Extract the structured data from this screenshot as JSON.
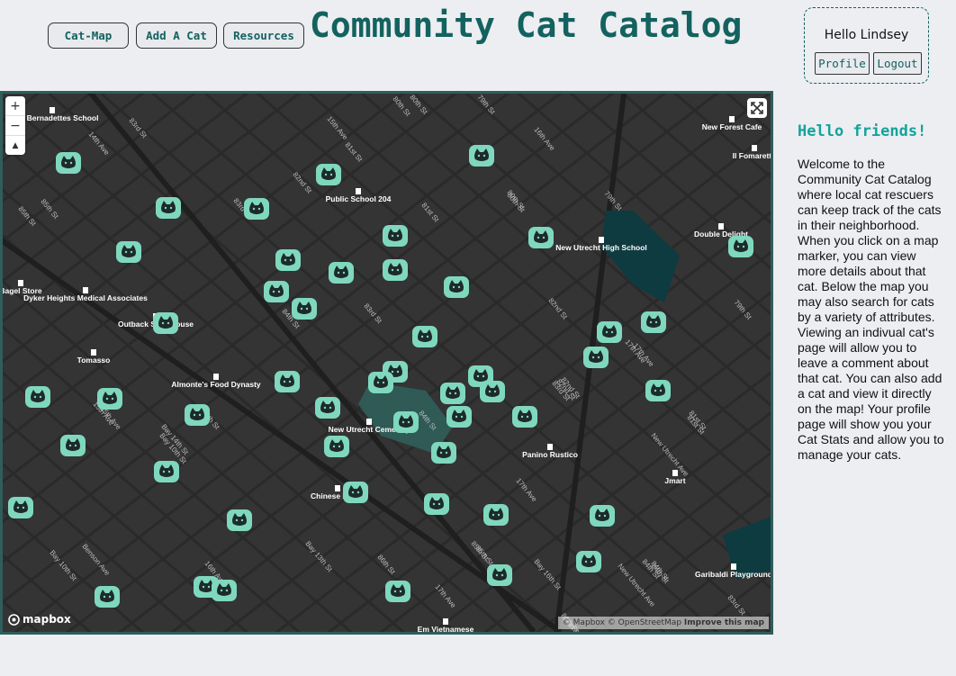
{
  "nav": {
    "cat_map": "Cat-Map",
    "add_cat": "Add A Cat",
    "resources": "Resources"
  },
  "title": "Community Cat Catalog",
  "user": {
    "greeting": "Hello Lindsey",
    "profile": "Profile",
    "logout": "Logout"
  },
  "map": {
    "zoom_in": "+",
    "zoom_out": "−",
    "compass": "▲",
    "logo_text": "mapbox",
    "attribution": {
      "mapbox": "© Mapbox",
      "osm": "© OpenStreetMap",
      "improve": "Improve this map"
    },
    "street_labels": [
      "83rd St",
      "15th Ave",
      "80th St",
      "79th St",
      "16th Ave",
      "14th Ave",
      "82nd St",
      "81st St",
      "80th St",
      "85th St",
      "83rd St",
      "79th St",
      "81st St",
      "80th St",
      "79th St",
      "82nd St",
      "84th St",
      "83rd St",
      "82nd St",
      "81st St",
      "17th Ave",
      "86th St",
      "15th Ave",
      "Bay 10th St",
      "84th St",
      "Bay 16th St",
      "Bay 13th St",
      "16th Ave",
      "85th St",
      "86th St",
      "17th Ave",
      "Benson Ave",
      "Bay 10th St",
      "85th St",
      "84th St",
      "83rd St",
      "New Utrecht Ave",
      "New Utrecht Ave",
      "17th Ave",
      "85th St",
      "81st St",
      "17th Ave",
      "85th St",
      "83rd St",
      "82nd St",
      "84th St",
      "80th St",
      "Bay 14th St",
      "15th Ave",
      "84th St",
      "85th St"
    ],
    "places": [
      {
        "name": "Saint Bernadettes School",
        "icon": "school-icon"
      },
      {
        "name": "Public School 204",
        "icon": "school-icon"
      },
      {
        "name": "New Forest Cafe",
        "icon": "restaurant-icon"
      },
      {
        "name": "Il Fomaretto",
        "icon": "restaurant-icon"
      },
      {
        "name": "New Utrecht High School",
        "icon": "school-icon"
      },
      {
        "name": "Double Delight",
        "icon": "restaurant-icon"
      },
      {
        "name": "Bagel Store",
        "icon": "shop-icon"
      },
      {
        "name": "Dyker Heights Medical Associates",
        "icon": "hospital-icon"
      },
      {
        "name": "Outback Steakhouse",
        "icon": "restaurant-icon"
      },
      {
        "name": "Tomasso",
        "icon": "restaurant-icon"
      },
      {
        "name": "Almonte's Food Dynasty",
        "icon": "shop-icon"
      },
      {
        "name": "New Utrecht Cemetery",
        "icon": "cemetery-icon"
      },
      {
        "name": "Panino Rustico",
        "icon": "restaurant-icon"
      },
      {
        "name": "Jmart",
        "icon": "shop-icon"
      },
      {
        "name": "Chinese Buffet",
        "icon": "restaurant-icon"
      },
      {
        "name": "Garibaldi Playground",
        "icon": "playground-icon"
      },
      {
        "name": "Em Vietnamese",
        "icon": "restaurant-icon"
      }
    ]
  },
  "sidebar": {
    "heading": "Hello friends!",
    "body": "Welcome to the Community Cat Catalog where local cat rescuers can keep track of the cats in their neighborhood. When you click on a map marker, you can view more details about that cat. Below the map you may also search for cats by a variety of attributes. Viewing an indivual cat's page will allow you to leave a comment about that cat. You can also add a cat and view it directly on the map! Your profile page will show you your Cat Stats and allow you to manage your cats."
  },
  "colors": {
    "accent": "#13625f",
    "heading": "#13a39a",
    "marker": "#7fd8bd",
    "map_bg": "#343434"
  }
}
